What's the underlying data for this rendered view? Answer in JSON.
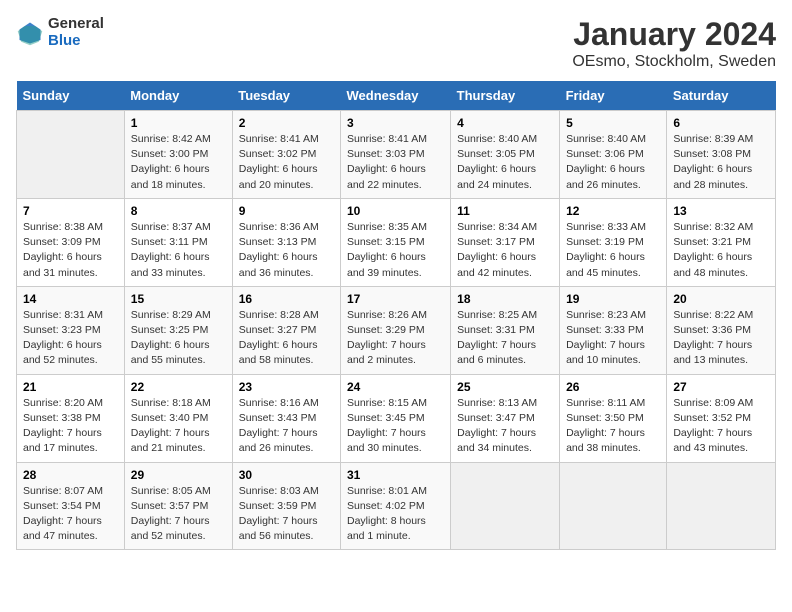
{
  "logo": {
    "general": "General",
    "blue": "Blue"
  },
  "title": "January 2024",
  "subtitle": "OEsmo, Stockholm, Sweden",
  "days_header": [
    "Sunday",
    "Monday",
    "Tuesday",
    "Wednesday",
    "Thursday",
    "Friday",
    "Saturday"
  ],
  "weeks": [
    [
      {
        "num": "",
        "detail": ""
      },
      {
        "num": "1",
        "detail": "Sunrise: 8:42 AM\nSunset: 3:00 PM\nDaylight: 6 hours\nand 18 minutes."
      },
      {
        "num": "2",
        "detail": "Sunrise: 8:41 AM\nSunset: 3:02 PM\nDaylight: 6 hours\nand 20 minutes."
      },
      {
        "num": "3",
        "detail": "Sunrise: 8:41 AM\nSunset: 3:03 PM\nDaylight: 6 hours\nand 22 minutes."
      },
      {
        "num": "4",
        "detail": "Sunrise: 8:40 AM\nSunset: 3:05 PM\nDaylight: 6 hours\nand 24 minutes."
      },
      {
        "num": "5",
        "detail": "Sunrise: 8:40 AM\nSunset: 3:06 PM\nDaylight: 6 hours\nand 26 minutes."
      },
      {
        "num": "6",
        "detail": "Sunrise: 8:39 AM\nSunset: 3:08 PM\nDaylight: 6 hours\nand 28 minutes."
      }
    ],
    [
      {
        "num": "7",
        "detail": "Sunrise: 8:38 AM\nSunset: 3:09 PM\nDaylight: 6 hours\nand 31 minutes."
      },
      {
        "num": "8",
        "detail": "Sunrise: 8:37 AM\nSunset: 3:11 PM\nDaylight: 6 hours\nand 33 minutes."
      },
      {
        "num": "9",
        "detail": "Sunrise: 8:36 AM\nSunset: 3:13 PM\nDaylight: 6 hours\nand 36 minutes."
      },
      {
        "num": "10",
        "detail": "Sunrise: 8:35 AM\nSunset: 3:15 PM\nDaylight: 6 hours\nand 39 minutes."
      },
      {
        "num": "11",
        "detail": "Sunrise: 8:34 AM\nSunset: 3:17 PM\nDaylight: 6 hours\nand 42 minutes."
      },
      {
        "num": "12",
        "detail": "Sunrise: 8:33 AM\nSunset: 3:19 PM\nDaylight: 6 hours\nand 45 minutes."
      },
      {
        "num": "13",
        "detail": "Sunrise: 8:32 AM\nSunset: 3:21 PM\nDaylight: 6 hours\nand 48 minutes."
      }
    ],
    [
      {
        "num": "14",
        "detail": "Sunrise: 8:31 AM\nSunset: 3:23 PM\nDaylight: 6 hours\nand 52 minutes."
      },
      {
        "num": "15",
        "detail": "Sunrise: 8:29 AM\nSunset: 3:25 PM\nDaylight: 6 hours\nand 55 minutes."
      },
      {
        "num": "16",
        "detail": "Sunrise: 8:28 AM\nSunset: 3:27 PM\nDaylight: 6 hours\nand 58 minutes."
      },
      {
        "num": "17",
        "detail": "Sunrise: 8:26 AM\nSunset: 3:29 PM\nDaylight: 7 hours\nand 2 minutes."
      },
      {
        "num": "18",
        "detail": "Sunrise: 8:25 AM\nSunset: 3:31 PM\nDaylight: 7 hours\nand 6 minutes."
      },
      {
        "num": "19",
        "detail": "Sunrise: 8:23 AM\nSunset: 3:33 PM\nDaylight: 7 hours\nand 10 minutes."
      },
      {
        "num": "20",
        "detail": "Sunrise: 8:22 AM\nSunset: 3:36 PM\nDaylight: 7 hours\nand 13 minutes."
      }
    ],
    [
      {
        "num": "21",
        "detail": "Sunrise: 8:20 AM\nSunset: 3:38 PM\nDaylight: 7 hours\nand 17 minutes."
      },
      {
        "num": "22",
        "detail": "Sunrise: 8:18 AM\nSunset: 3:40 PM\nDaylight: 7 hours\nand 21 minutes."
      },
      {
        "num": "23",
        "detail": "Sunrise: 8:16 AM\nSunset: 3:43 PM\nDaylight: 7 hours\nand 26 minutes."
      },
      {
        "num": "24",
        "detail": "Sunrise: 8:15 AM\nSunset: 3:45 PM\nDaylight: 7 hours\nand 30 minutes."
      },
      {
        "num": "25",
        "detail": "Sunrise: 8:13 AM\nSunset: 3:47 PM\nDaylight: 7 hours\nand 34 minutes."
      },
      {
        "num": "26",
        "detail": "Sunrise: 8:11 AM\nSunset: 3:50 PM\nDaylight: 7 hours\nand 38 minutes."
      },
      {
        "num": "27",
        "detail": "Sunrise: 8:09 AM\nSunset: 3:52 PM\nDaylight: 7 hours\nand 43 minutes."
      }
    ],
    [
      {
        "num": "28",
        "detail": "Sunrise: 8:07 AM\nSunset: 3:54 PM\nDaylight: 7 hours\nand 47 minutes."
      },
      {
        "num": "29",
        "detail": "Sunrise: 8:05 AM\nSunset: 3:57 PM\nDaylight: 7 hours\nand 52 minutes."
      },
      {
        "num": "30",
        "detail": "Sunrise: 8:03 AM\nSunset: 3:59 PM\nDaylight: 7 hours\nand 56 minutes."
      },
      {
        "num": "31",
        "detail": "Sunrise: 8:01 AM\nSunset: 4:02 PM\nDaylight: 8 hours\nand 1 minute."
      },
      {
        "num": "",
        "detail": ""
      },
      {
        "num": "",
        "detail": ""
      },
      {
        "num": "",
        "detail": ""
      }
    ]
  ]
}
